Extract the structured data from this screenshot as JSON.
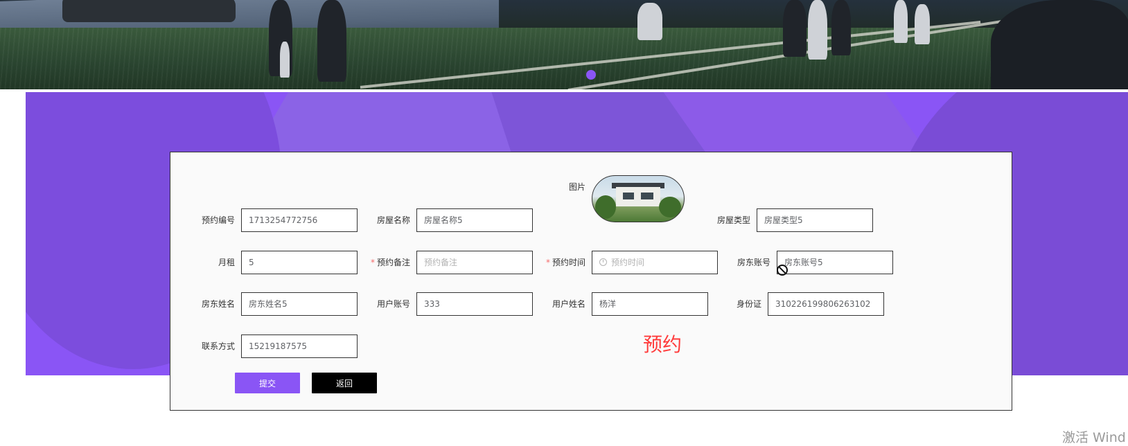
{
  "banner": {
    "carousel_dots": 1
  },
  "form": {
    "fields": [
      {
        "label": "预约编号",
        "value": "1713254772756",
        "required": false
      },
      {
        "label": "房屋名称",
        "value": "房屋名称5",
        "required": false
      },
      {
        "label": "房屋类型",
        "value": "房屋类型5",
        "required": false
      },
      {
        "label": "月租",
        "value": "5",
        "required": false
      },
      {
        "label": "预约备注",
        "placeholder": "预约备注",
        "required": true,
        "required_mark": "*"
      },
      {
        "label": "预约时间",
        "placeholder": "预约时间",
        "required": true,
        "required_mark": "*"
      },
      {
        "label": "房东账号",
        "value": "房东账号5",
        "required": false
      },
      {
        "label": "房东姓名",
        "value": "房东姓名5",
        "required": false
      },
      {
        "label": "用户账号",
        "value": "333",
        "required": false
      },
      {
        "label": "用户姓名",
        "value": "杨洋",
        "required": false
      },
      {
        "label": "身份证",
        "value": "310226199806263102",
        "required": false
      },
      {
        "label": "联系方式",
        "value": "15219187575",
        "required": false
      }
    ],
    "image_label": "图片",
    "title": "预约",
    "buttons": {
      "submit": "提交",
      "back": "返回"
    }
  },
  "cursor": {
    "icon": "not-allowed-cursor-icon"
  },
  "watermark": "激活 Wind",
  "colors": {
    "accent": "#8a55f5",
    "title_red": "#ff3b3b",
    "required_red": "#f56c6c",
    "back_button": "#000000"
  }
}
